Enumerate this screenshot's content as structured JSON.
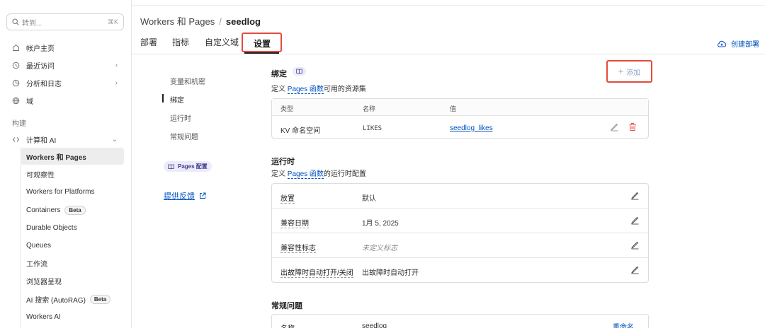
{
  "search": {
    "placeholder": "转到...",
    "shortcut": "⌘K"
  },
  "sidebar": {
    "top_items": [
      {
        "label": "帐户主页",
        "icon": "home-icon",
        "has_chevron": false
      },
      {
        "label": "最近访问",
        "icon": "clock-icon",
        "has_chevron": true
      },
      {
        "label": "分析和日志",
        "icon": "chart-pie-icon",
        "has_chevron": true
      },
      {
        "label": "域",
        "icon": "globe-icon",
        "has_chevron": false
      }
    ],
    "section_label": "构建",
    "group": {
      "label": "计算和 AI",
      "icon": "code-icon",
      "expanded": true
    },
    "sub_items": [
      {
        "label": "Workers 和 Pages",
        "active": true,
        "badge": ""
      },
      {
        "label": "可观察性",
        "active": false,
        "badge": ""
      },
      {
        "label": "Workers for Platforms",
        "active": false,
        "badge": ""
      },
      {
        "label": "Containers",
        "active": false,
        "badge": "Beta"
      },
      {
        "label": "Durable Objects",
        "active": false,
        "badge": ""
      },
      {
        "label": "Queues",
        "active": false,
        "badge": ""
      },
      {
        "label": "工作流",
        "active": false,
        "badge": ""
      },
      {
        "label": "浏览器呈现",
        "active": false,
        "badge": ""
      },
      {
        "label": "AI 搜索 (AutoRAG)",
        "active": false,
        "badge": "Beta"
      },
      {
        "label": "Workers AI",
        "active": false,
        "badge": ""
      }
    ]
  },
  "header": {
    "breadcrumb_parent": "Workers 和 Pages",
    "breadcrumb_sep": "/",
    "breadcrumb_current": "seedlog",
    "tabs": [
      "部署",
      "指标",
      "自定义域",
      "设置"
    ],
    "active_tab": "设置",
    "create_deploy": "创建部署"
  },
  "settings_nav": {
    "items": [
      "变量和机密",
      "绑定",
      "运行时",
      "常规问题"
    ],
    "active": "绑定",
    "pages_config": "Pages 配置",
    "feedback": "提供反馈"
  },
  "bindings": {
    "title": "绑定",
    "desc_prefix": "定义 ",
    "desc_link": "Pages 函数",
    "desc_suffix": "可用的资源集",
    "add_label": "添加",
    "columns": [
      "类型",
      "名称",
      "值"
    ],
    "rows": [
      {
        "type": "KV 命名空间",
        "name": "LIKES",
        "value": "seedlog_likes"
      }
    ]
  },
  "runtime": {
    "title": "运行时",
    "desc_prefix": "定义 ",
    "desc_link": "Pages 函数",
    "desc_suffix": "的运行时配置",
    "rows": [
      {
        "key": "放置",
        "value": "默认",
        "placeholder": false
      },
      {
        "key": "兼容日期",
        "value": "1月 5, 2025",
        "placeholder": false
      },
      {
        "key": "兼容性标志",
        "value": "未定义标志",
        "placeholder": true
      },
      {
        "key": "出故障时自动打开/关闭",
        "value": "出故障时自动打开",
        "placeholder": false
      }
    ]
  },
  "general": {
    "title": "常规问题",
    "name_key": "名称",
    "name_value": "seedlog",
    "rename": "重命名"
  },
  "colors": {
    "link": "#0051c3",
    "highlight": "#e44b3d",
    "danger": "#e5534b"
  }
}
